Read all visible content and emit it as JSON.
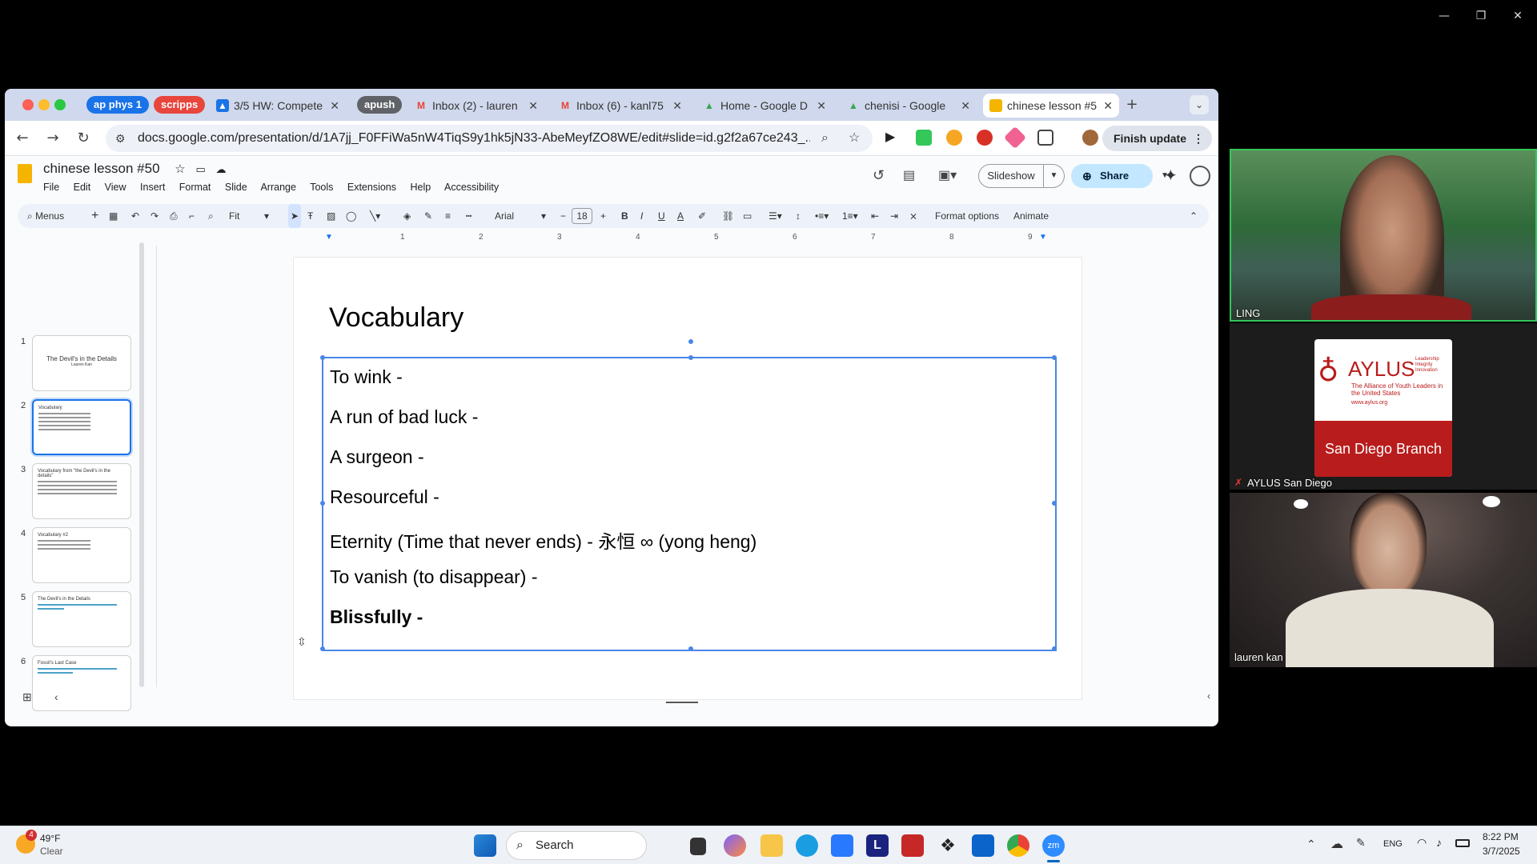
{
  "browser": {
    "tab_groups": [
      {
        "label": "ap phys 1",
        "color": "#1a73e8"
      },
      {
        "label": "scripps",
        "color": "#e8453c"
      },
      {
        "label": "apush",
        "color": "#5f6368"
      }
    ],
    "tabs": [
      {
        "label": "3/5 HW: Compete",
        "icon_color": "#1a73e8"
      },
      {
        "label": "Inbox (2) - lauren",
        "icon_color": "#ea4335"
      },
      {
        "label": "Inbox (6) - kanl75",
        "icon_color": "#ea4335"
      },
      {
        "label": "Home - Google D",
        "icon_color": "#34a853"
      },
      {
        "label": "chenisi - Google",
        "icon_color": "#34a853"
      },
      {
        "label": "chinese lesson #5",
        "icon_color": "#f4b400"
      }
    ],
    "url": "docs.google.com/presentation/d/1A7jj_F0FFiWa5nW4TiqS9y1hk5jN33-AbeMeyfZO8WE/edit#slide=id.g2f2a67ce243_...",
    "finish_update": "Finish update"
  },
  "doc": {
    "title": "chinese lesson #50",
    "menus": [
      "File",
      "Edit",
      "View",
      "Insert",
      "Format",
      "Slide",
      "Arrange",
      "Tools",
      "Extensions",
      "Help",
      "Accessibility"
    ],
    "slideshow": "Slideshow",
    "share": "Share"
  },
  "toolbar": {
    "menus": "Menus",
    "zoom": "Fit",
    "font": "Arial",
    "font_size": "18",
    "format_options": "Format options",
    "animate": "Animate"
  },
  "ruler": [
    "1",
    "2",
    "3",
    "4",
    "5",
    "6",
    "7",
    "8",
    "9"
  ],
  "thumbnails": [
    {
      "num": "1",
      "title": "The Devil's in the Details",
      "sub": "Lauren Kan"
    },
    {
      "num": "2",
      "title": "Vocabulary"
    },
    {
      "num": "3",
      "title": "Vocabulary from \"the Devil's in the details\""
    },
    {
      "num": "4",
      "title": "Vocabulary #2"
    },
    {
      "num": "5",
      "title": "The Devil's in the Details"
    },
    {
      "num": "6",
      "title": "Fossil's Last Case"
    }
  ],
  "slide": {
    "title": "Vocabulary",
    "items": [
      "To wink -",
      "A run of bad luck -",
      "A surgeon -",
      "Resourceful -",
      "Eternity (Time that never ends) - 永恒 ∞ (yong heng)",
      "To vanish (to disappear) -",
      "Blissfully -"
    ]
  },
  "participants": [
    {
      "name": "LING"
    },
    {
      "name": "AYLUS San Diego",
      "logo_title": "AYLUS",
      "logo_tagline": "Leadership Integrity Innovation",
      "logo_sub": "The Alliance of Youth Leaders in the United States",
      "logo_url": "www.aylus.org",
      "branch": "San Diego Branch"
    },
    {
      "name": "lauren kan"
    }
  ],
  "taskbar": {
    "weather_temp": "49°F",
    "weather_desc": "Clear",
    "weather_badge": "4",
    "search": "Search",
    "lang": "ENG",
    "time": "8:22 PM",
    "date": "3/7/2025"
  }
}
